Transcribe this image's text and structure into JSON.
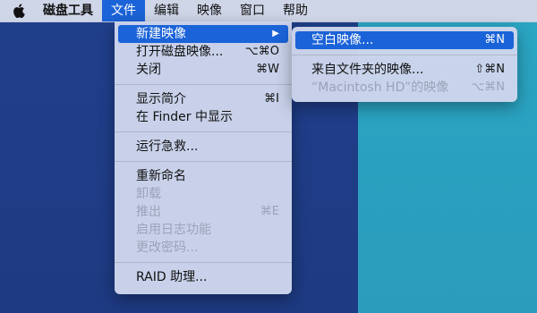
{
  "menubar": {
    "app_name": "磁盘工具",
    "items": [
      "文件",
      "编辑",
      "映像",
      "窗口",
      "帮助"
    ]
  },
  "file_menu": {
    "groups": [
      [
        {
          "label": "新建映像",
          "shortcut": "",
          "has_submenu": true,
          "highlighted": true,
          "disabled": false
        },
        {
          "label": "打开磁盘映像...",
          "shortcut": "⌥⌘O"
        },
        {
          "label": "关闭",
          "shortcut": "⌘W"
        }
      ],
      [
        {
          "label": "显示简介",
          "shortcut": "⌘I"
        },
        {
          "label": "在 Finder 中显示",
          "shortcut": ""
        }
      ],
      [
        {
          "label": "运行急救...",
          "shortcut": ""
        }
      ],
      [
        {
          "label": "重新命名",
          "shortcut": ""
        },
        {
          "label": "卸载",
          "shortcut": "",
          "disabled": true
        },
        {
          "label": "推出",
          "shortcut": "⌘E",
          "disabled": true
        },
        {
          "label": "启用日志功能",
          "shortcut": "",
          "disabled": true
        },
        {
          "label": "更改密码...",
          "shortcut": "",
          "disabled": true
        }
      ],
      [
        {
          "label": "RAID 助理...",
          "shortcut": ""
        }
      ]
    ]
  },
  "submenu": {
    "items": [
      {
        "label": "空白映像...",
        "shortcut": "⌘N",
        "highlighted": true
      },
      {
        "label": "来自文件夹的映像...",
        "shortcut": "⇧⌘N"
      },
      {
        "label": "“Macintosh HD”的映像",
        "shortcut": "⌥⌘N",
        "disabled": true
      }
    ]
  },
  "colors": {
    "highlight": "#1b63d8",
    "desktop_blue": "#1f3c86",
    "desktop_teal": "#2aa6c3"
  },
  "icons": [
    "apple-icon",
    "submenu-arrow-icon"
  ]
}
